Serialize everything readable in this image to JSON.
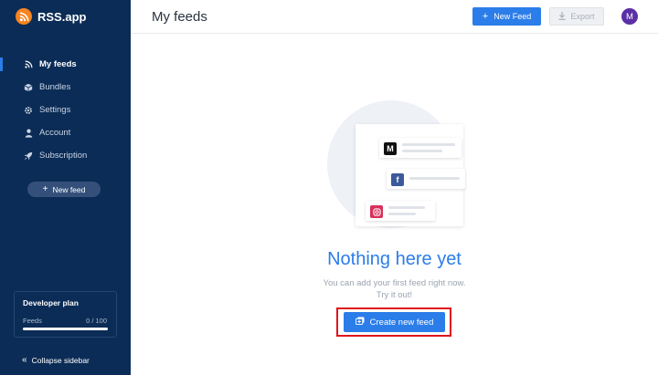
{
  "app": {
    "name": "RSS.app"
  },
  "sidebar": {
    "items": [
      {
        "label": "My feeds",
        "icon": "rss-icon",
        "active": true
      },
      {
        "label": "Bundles",
        "icon": "cube-icon",
        "active": false
      },
      {
        "label": "Settings",
        "icon": "gear-icon",
        "active": false
      },
      {
        "label": "Account",
        "icon": "user-icon",
        "active": false
      },
      {
        "label": "Subscription",
        "icon": "rocket-icon",
        "active": false
      }
    ],
    "new_feed_label": "New feed",
    "plan": {
      "title": "Developer plan",
      "feeds_label": "Feeds",
      "count_text": "0 / 100",
      "usage_fraction": 0
    },
    "collapse_label": "Collapse sidebar"
  },
  "header": {
    "title": "My feeds",
    "new_feed_label": "New Feed",
    "export_label": "Export",
    "avatar_initial": "M"
  },
  "main": {
    "empty_title": "Nothing here yet",
    "empty_line1": "You can add your first feed right now.",
    "empty_line2": "Try it out!",
    "create_label": "Create new feed",
    "illustration_icons": [
      "medium-icon",
      "facebook-icon",
      "instagram-icon"
    ]
  },
  "colors": {
    "sidebar": "#0b2c56",
    "accent": "#2b7de9",
    "highlight": "#e0141b",
    "avatar": "#5b2fa6",
    "logo": "#f7841f"
  }
}
